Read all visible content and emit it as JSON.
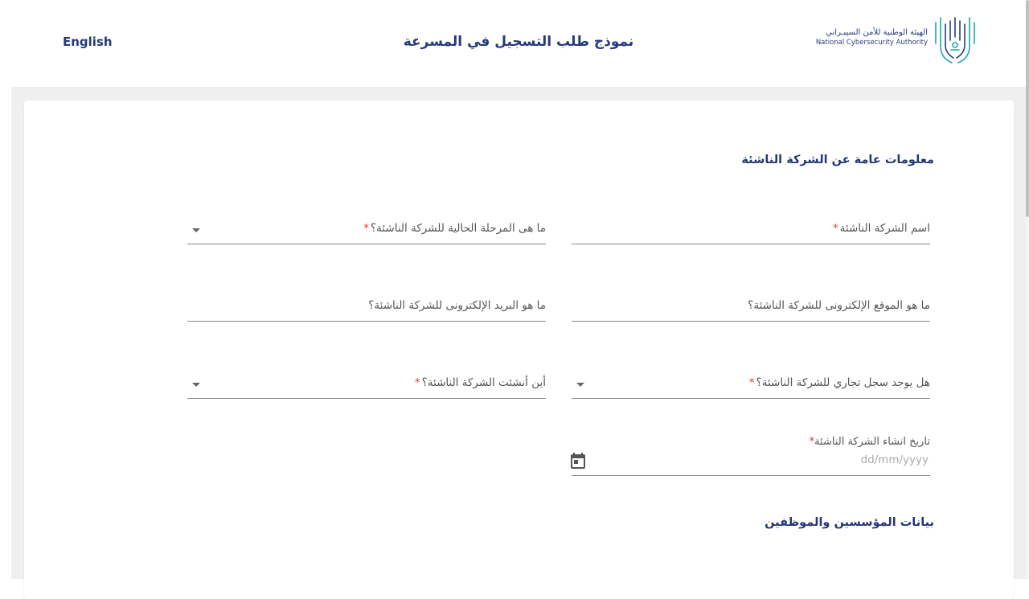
{
  "header": {
    "language_link": "English",
    "title": "نموذج طلب التسجيل في المسرعة",
    "logo_text_ar": "الهيئة الوطنية للأمن السيبـراني",
    "logo_text_en": "National Cybersecurity Authority"
  },
  "section_general": {
    "title": "معلومات عامة عن الشركة الناشئة"
  },
  "fields": {
    "startup_name": {
      "label": "اسم الشركة الناشئة",
      "required_mark": "*"
    },
    "current_stage": {
      "label": "ما هى المرحلة الحالية للشركة الناشئة؟",
      "required_mark": "*"
    },
    "website": {
      "label": "ما هو الموقع الإلكترونى للشركة الناشئة؟"
    },
    "email": {
      "label": "ما هو البريد الإلكترونى للشركة الناشئة؟"
    },
    "commercial_register": {
      "label": "هل يوجد سجل تجاري للشركة الناشئة؟",
      "required_mark": "*"
    },
    "founded_where": {
      "label": "أين أنشئت الشركة الناشئة؟",
      "required_mark": "*"
    },
    "founded_date": {
      "label": "تاريخ انشاء الشركة الناشئة",
      "required_mark": "*",
      "placeholder": "dd/mm/yyyy",
      "value": ""
    }
  },
  "section_founders": {
    "title": "بيانات المؤسسين والموظفين"
  },
  "colors": {
    "primary_text": "#243678",
    "required": "#e53935",
    "background": "#efefef",
    "logo_teal": "#1ea6b3"
  }
}
